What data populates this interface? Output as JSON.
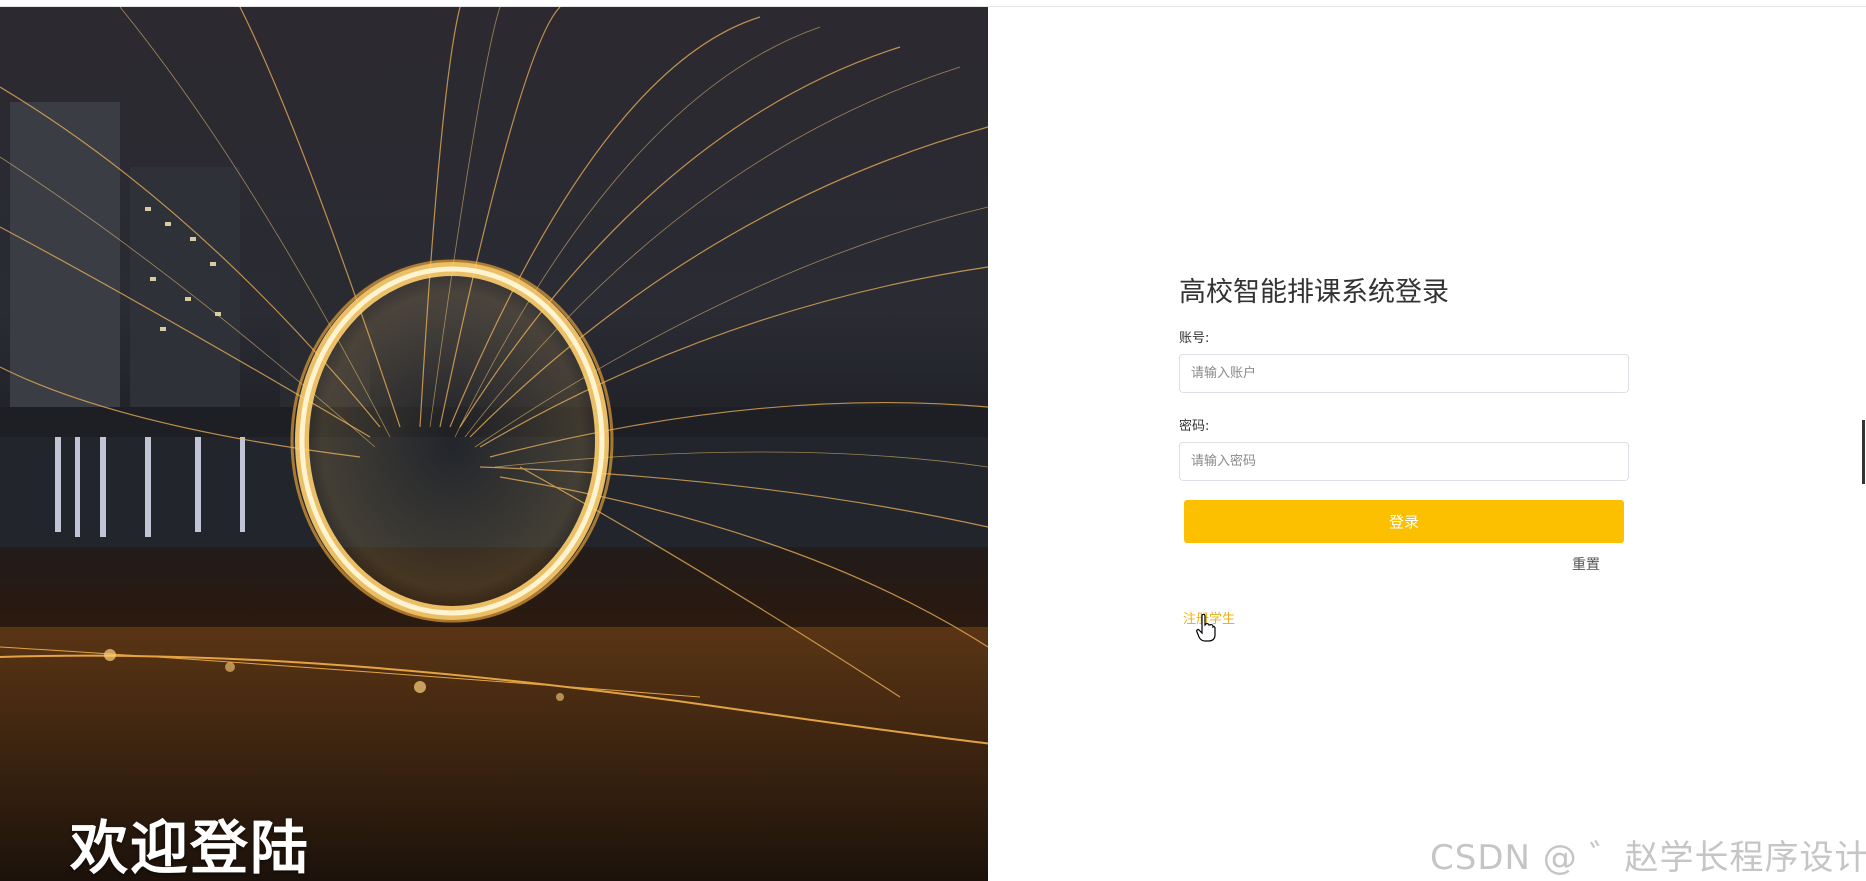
{
  "hero": {
    "welcome_text": "欢迎登陆"
  },
  "login": {
    "title": "高校智能排课系统登录",
    "account_label": "账号:",
    "account_placeholder": "请输入账户",
    "password_label": "密码:",
    "password_placeholder": "请输入密码",
    "login_button": "登录",
    "reset_button": "重置",
    "register_link": "注册学生"
  },
  "watermark": "CSDN @ ゛赵学长程序设计",
  "colors": {
    "accent": "#fcc000",
    "link": "#e8b21a"
  },
  "icons": {
    "cursor": "hand-pointer-icon"
  }
}
